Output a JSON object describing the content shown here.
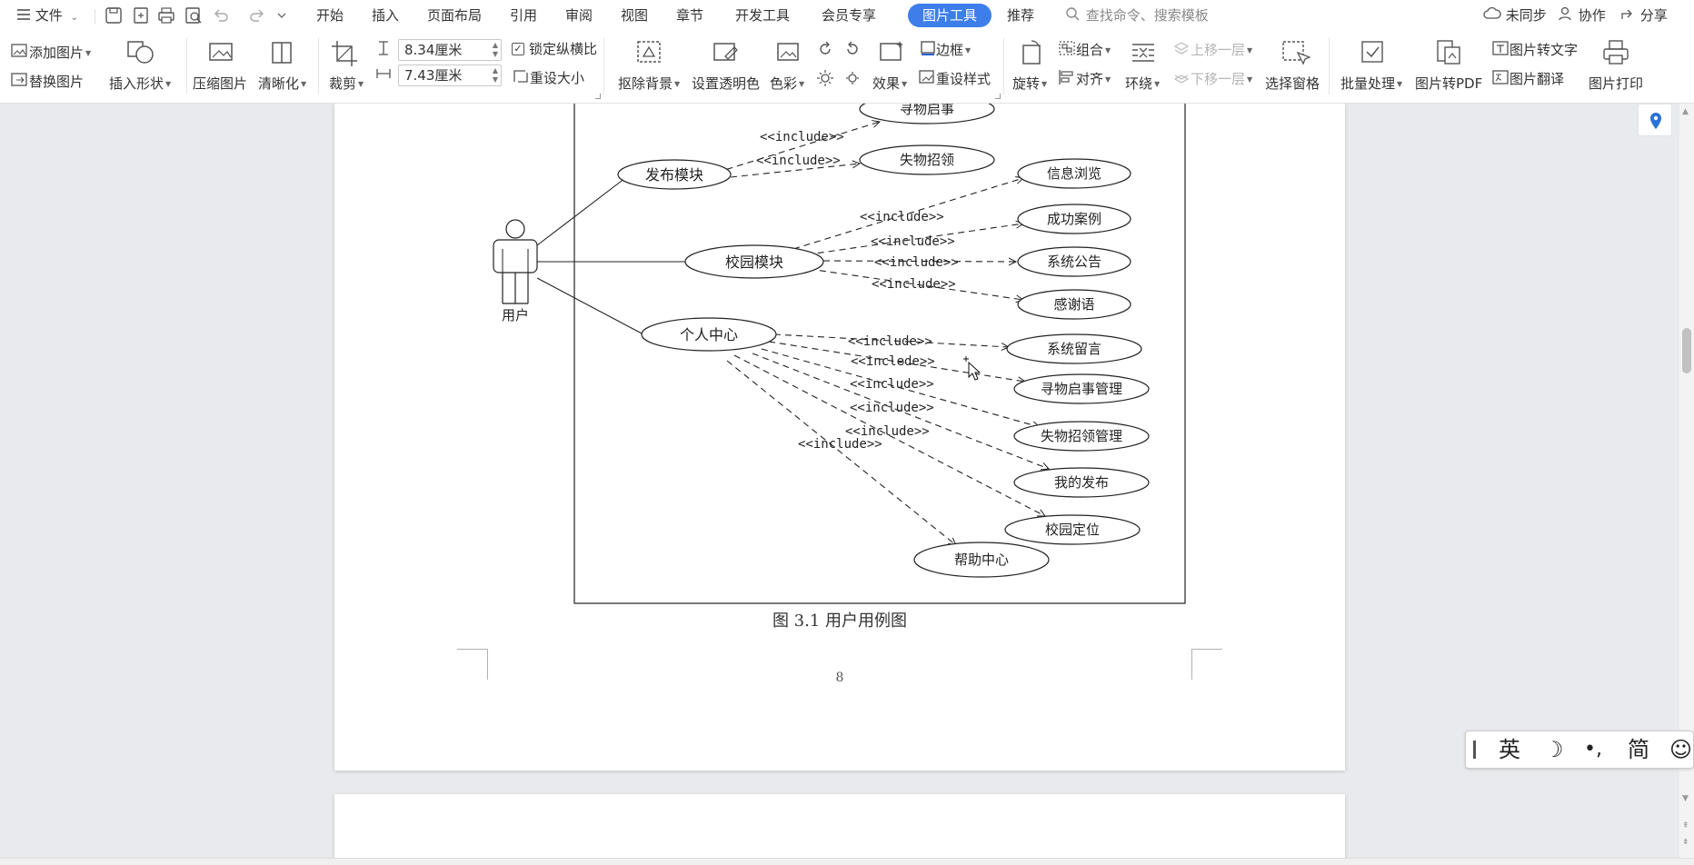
{
  "menubar": {
    "file_label": "文件",
    "tabs": [
      "开始",
      "插入",
      "页面布局",
      "引用",
      "审阅",
      "视图",
      "章节",
      "开发工具",
      "会员专享"
    ],
    "active_tab": "图片工具",
    "recommend_tab": "推荐",
    "search_placeholder": "查找命令、搜索模板",
    "sync_label": "未同步",
    "collab_label": "协作",
    "share_label": "分享"
  },
  "ribbon": {
    "add_picture": "添加图片",
    "replace_picture": "替换图片",
    "insert_shape": "插入形状",
    "compress_picture": "压缩图片",
    "sharpen": "清晰化",
    "crop": "裁剪",
    "height_value": "8.34厘米",
    "width_value": "7.43厘米",
    "lock_aspect": "锁定纵横比",
    "reset_size": "重设大小",
    "remove_bg": "抠除背景",
    "set_transparent": "设置透明色",
    "color": "色彩",
    "effects": "效果",
    "border": "边框",
    "reset_style": "重设样式",
    "rotate": "旋转",
    "group": "组合",
    "align": "对齐",
    "wrap": "环绕",
    "bring_forward": "上移一层",
    "send_backward": "下移一层",
    "selection_pane": "选择窗格",
    "batch_process": "批量处理",
    "to_pdf": "图片转PDF",
    "to_text": "图片转文字",
    "translate": "图片翻译",
    "print": "图片打印"
  },
  "diagram": {
    "actor": "用户",
    "modules": [
      "发布模块",
      "校园模块",
      "个人中心"
    ],
    "publish_cases": [
      "寻物启事",
      "失物招领"
    ],
    "campus_cases": [
      "信息浏览",
      "成功案例",
      "系统公告",
      "感谢语"
    ],
    "personal_cases": [
      "系统留言",
      "寻物启事管理",
      "失物招领管理",
      "我的发布",
      "校园定位",
      "帮助中心"
    ],
    "include_label": "<<include>>",
    "include_typo": "<<inclede>>"
  },
  "document": {
    "caption": "图 3.1  用户用例图",
    "page_number": "8"
  },
  "ime": {
    "lang": "英",
    "punct": "•,",
    "simplified": "简"
  }
}
